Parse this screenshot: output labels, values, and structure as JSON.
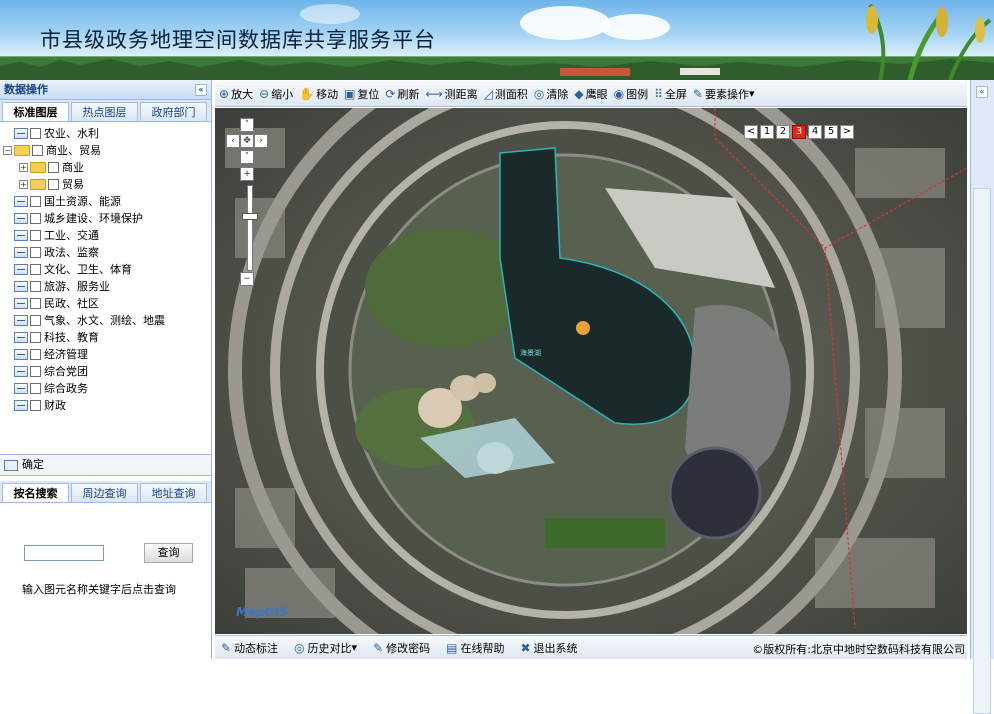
{
  "header": {
    "title": "市县级政务地理空间数据库共享服务平台"
  },
  "left_panel": {
    "title": "数据操作",
    "collapse_icon": "«",
    "tabs": [
      "标准图层",
      "热点图层",
      "政府部门"
    ],
    "tree": [
      {
        "label": "农业、水利",
        "type": "layer",
        "level": 0
      },
      {
        "label": "商业、贸易",
        "type": "folder",
        "level": 0,
        "expanded": true
      },
      {
        "label": "商业",
        "type": "folder",
        "level": 1
      },
      {
        "label": "贸易",
        "type": "folder",
        "level": 1
      },
      {
        "label": "国土资源、能源",
        "type": "layer",
        "level": 0
      },
      {
        "label": "城乡建设、环境保护",
        "type": "layer",
        "level": 0
      },
      {
        "label": "工业、交通",
        "type": "layer",
        "level": 0
      },
      {
        "label": "政法、监察",
        "type": "layer",
        "level": 0
      },
      {
        "label": "文化、卫生、体育",
        "type": "layer",
        "level": 0
      },
      {
        "label": "旅游、服务业",
        "type": "layer",
        "level": 0
      },
      {
        "label": "民政、社区",
        "type": "layer",
        "level": 0
      },
      {
        "label": "气象、水文、测绘、地震",
        "type": "layer",
        "level": 0
      },
      {
        "label": "科技、教育",
        "type": "layer",
        "level": 0
      },
      {
        "label": "经济管理",
        "type": "layer",
        "level": 0
      },
      {
        "label": "综合党团",
        "type": "layer",
        "level": 0
      },
      {
        "label": "综合政务",
        "type": "layer",
        "level": 0
      },
      {
        "label": "财政",
        "type": "layer",
        "level": 0
      }
    ],
    "confirm_label": "确定",
    "search_tabs": [
      "按名搜索",
      "周边查询",
      "地址查询"
    ],
    "search_input_value": "",
    "query_button": "查询",
    "hint": "输入图元名称关键字后点击查询"
  },
  "toolbar": [
    {
      "label": "放大",
      "icon": "zoom-in-icon",
      "glyph": "⊕"
    },
    {
      "label": "缩小",
      "icon": "zoom-out-icon",
      "glyph": "⊖"
    },
    {
      "label": "移动",
      "icon": "hand-icon",
      "glyph": "✋"
    },
    {
      "label": "复位",
      "icon": "reset-icon",
      "glyph": "▣"
    },
    {
      "label": "刷新",
      "icon": "refresh-icon",
      "glyph": "⟳"
    },
    {
      "label": "测距离",
      "icon": "ruler-icon",
      "glyph": "⟷"
    },
    {
      "label": "测面积",
      "icon": "area-icon",
      "glyph": "◿"
    },
    {
      "label": "清除",
      "icon": "clear-icon",
      "glyph": "◎"
    },
    {
      "label": "鹰眼",
      "icon": "eagle-eye-icon",
      "glyph": "◆"
    },
    {
      "label": "图例",
      "icon": "legend-icon",
      "glyph": "◉"
    },
    {
      "label": "全屏",
      "icon": "fullscreen-icon",
      "glyph": "⠿"
    },
    {
      "label": "要素操作",
      "icon": "feature-icon",
      "glyph": "✎",
      "dropdown": "▾"
    }
  ],
  "map": {
    "pager": [
      "<",
      "1",
      "2",
      "3",
      "4",
      "5",
      ">"
    ],
    "current_page": "3",
    "water_label": "海景湖",
    "logo": "MapGIS"
  },
  "statusbar": {
    "items": [
      {
        "label": "动态标注",
        "glyph": "✎",
        "icon": "annotate-icon"
      },
      {
        "label": "历史对比",
        "glyph": "◎",
        "icon": "history-icon",
        "dropdown": "▾"
      },
      {
        "label": "修改密码",
        "glyph": "✎",
        "icon": "password-icon"
      },
      {
        "label": "在线帮助",
        "glyph": "▤",
        "icon": "help-icon"
      },
      {
        "label": "退出系统",
        "glyph": "✖",
        "icon": "exit-icon"
      }
    ],
    "copyright": "©版权所有:北京中地时空数码科技有限公司"
  },
  "right_panel": {
    "collapse_icon": "«"
  }
}
